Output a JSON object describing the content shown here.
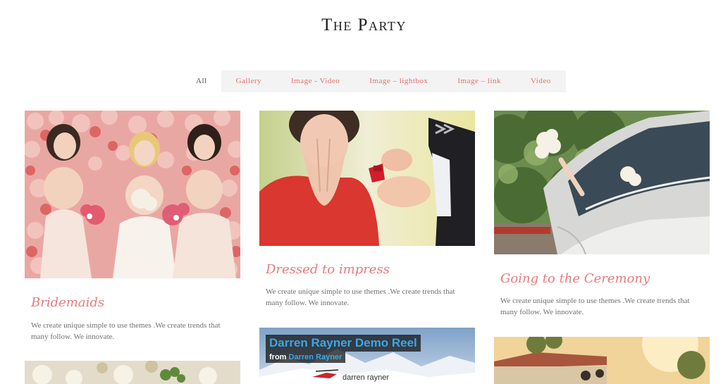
{
  "site": {
    "title": "The Party"
  },
  "filters": [
    "All",
    "Gallery",
    "Image - Video",
    "Image – lightbox",
    "Image – link",
    "Video"
  ],
  "cards": [
    {
      "title": "Bridemaids",
      "text": "We create unique simple to use themes .We create trends that many follow. We innovate."
    },
    {
      "title": "Dressed to impress",
      "text": "We create unique simple to use themes .We create trends that many follow. We innovate."
    },
    {
      "title": "Going to the Ceremony",
      "text": "We create unique simple to use themes .We create trends that many follow. We innovate."
    }
  ],
  "video": {
    "title": "Darren Rayner Demo Reel",
    "from_label": "from",
    "author": "Darren Rayner",
    "brand": "darren rayner"
  },
  "colors": {
    "accent": "#e57c7c",
    "filter_bg": "#f3f3f3",
    "video_link": "#3aa7e6"
  }
}
